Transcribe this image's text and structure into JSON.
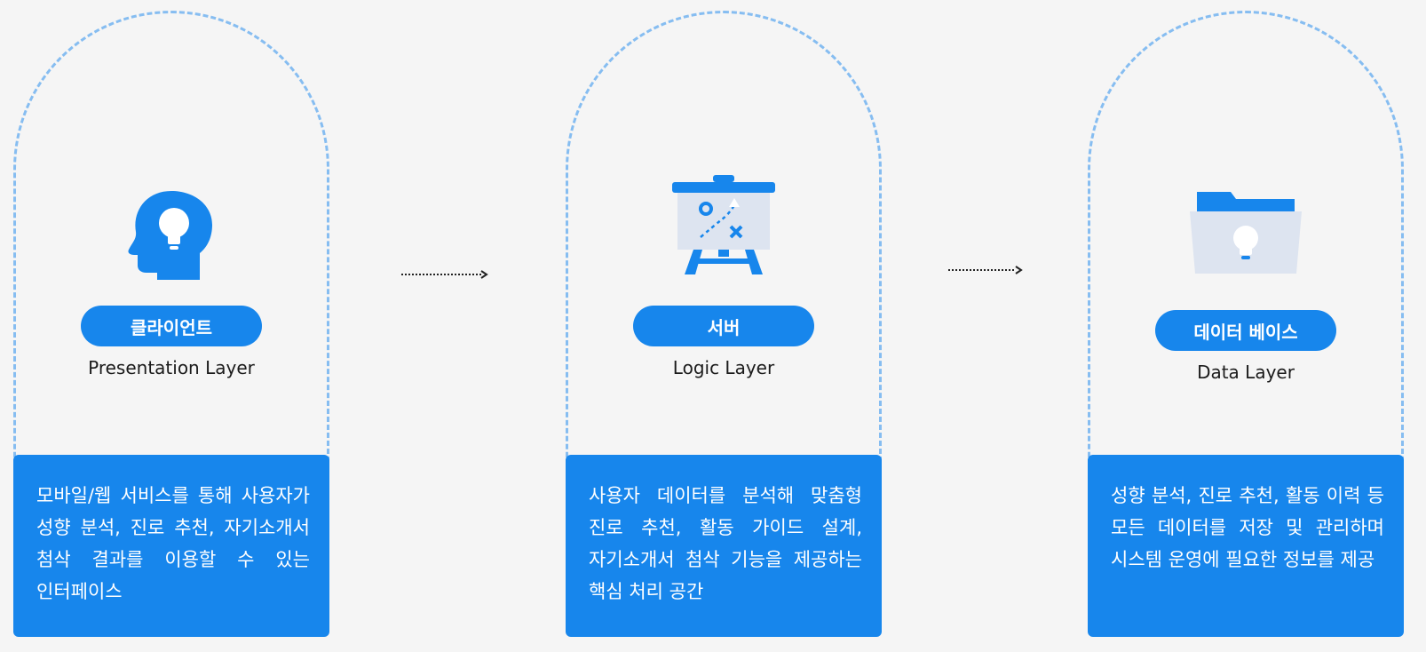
{
  "columns": [
    {
      "title": "클라이언트",
      "layer": "Presentation Layer",
      "description": "모바일/웹 서비스를 통해 사용자가 성향 분석, 진로 추천, 자기소개서 첨삭 결과를 이용할 수 있는 인터페이스",
      "icon": "head-lightbulb-icon"
    },
    {
      "title": "서버",
      "layer": "Logic Layer",
      "description": "사용자 데이터를 분석해 맞춤형 진로 추천, 활동 가이드 설계, 자기소개서 첨삭 기능을 제공하는 핵심 처리 공간",
      "icon": "strategy-board-icon"
    },
    {
      "title": "데이터 베이스",
      "layer": "Data Layer",
      "description": "성향 분석, 진로 추천, 활동 이력 등 모든 데이터를 저장 및 관리하며 시스템 운영에 필요한 정보를 제공",
      "icon": "folder-lightbulb-icon"
    }
  ],
  "colors": {
    "accent": "#1786ec",
    "dashed_outline": "#86bdf1",
    "background": "#f5f5f5",
    "icon_light": "#dde4f0"
  }
}
